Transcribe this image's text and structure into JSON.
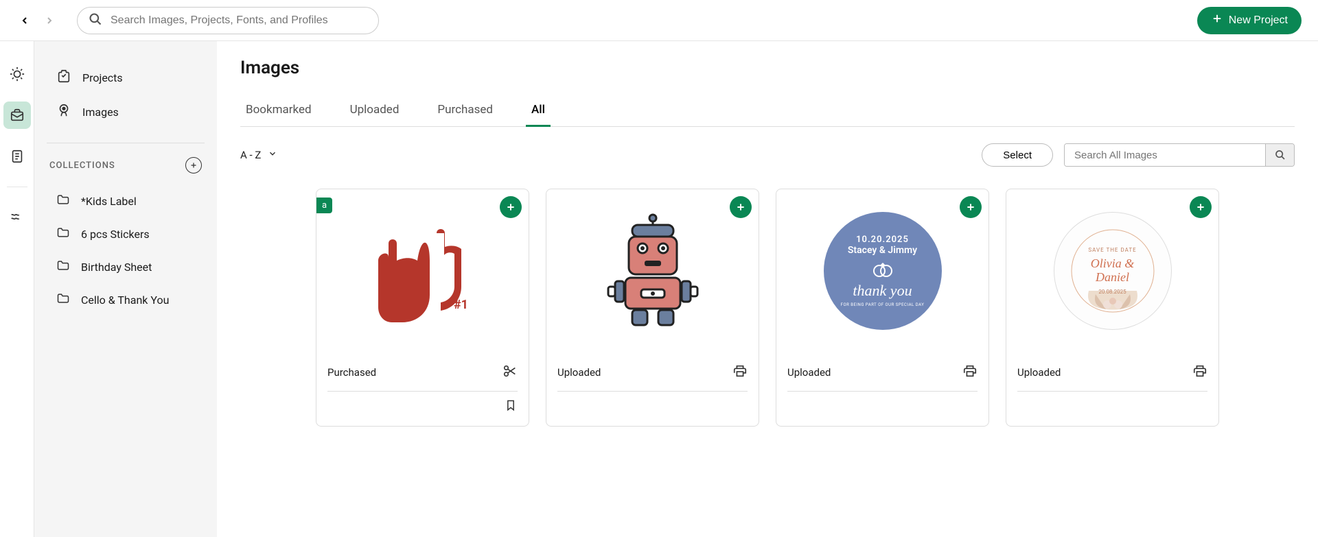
{
  "header": {
    "search_placeholder": "Search Images, Projects, Fonts, and Profiles",
    "new_project_label": "New Project"
  },
  "sidebar": {
    "nav": [
      {
        "label": "Projects"
      },
      {
        "label": "Images"
      }
    ],
    "collections_label": "COLLECTIONS",
    "collections": [
      {
        "label": "*Kids Label"
      },
      {
        "label": "6 pcs Stickers"
      },
      {
        "label": "Birthday Sheet"
      },
      {
        "label": "Cello & Thank You"
      }
    ]
  },
  "content": {
    "page_title": "Images",
    "tabs": [
      {
        "label": "Bookmarked"
      },
      {
        "label": "Uploaded"
      },
      {
        "label": "Purchased"
      },
      {
        "label": "All"
      }
    ],
    "sort_label": "A - Z",
    "select_label": "Select",
    "search_placeholder": "Search All Images",
    "cards": [
      {
        "status": "Purchased",
        "badge": "a",
        "action_icon": "cut",
        "has_bookmark": true,
        "preview": "foam-finger"
      },
      {
        "status": "Uploaded",
        "action_icon": "print",
        "preview": "robot"
      },
      {
        "status": "Uploaded",
        "action_icon": "print",
        "preview": "thankyou",
        "thankyou": {
          "date": "10.20.2025",
          "names": "Stacey & Jimmy",
          "main": "thank you",
          "sub": "FOR BEING PART OF OUR SPECIAL DAY"
        }
      },
      {
        "status": "Uploaded",
        "action_icon": "print",
        "preview": "savethedate",
        "savethedate": {
          "top": "SAVE THE DATE",
          "names": "Olivia & Daniel",
          "date": "20.08.2025"
        }
      }
    ]
  }
}
